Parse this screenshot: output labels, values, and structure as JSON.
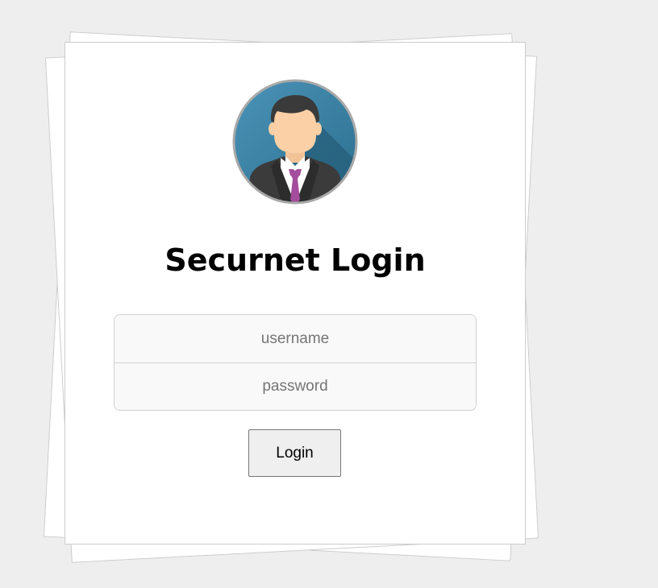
{
  "page": {
    "title": "Securnet Login"
  },
  "avatar": {
    "icon": "businessman-avatar-icon",
    "colors": {
      "background": "#3c7fa0",
      "ring": "#a9a9a9",
      "tie": "#a44d9c"
    }
  },
  "form": {
    "username": {
      "placeholder": "username",
      "value": ""
    },
    "password": {
      "placeholder": "password",
      "value": ""
    },
    "submit_label": "Login"
  }
}
